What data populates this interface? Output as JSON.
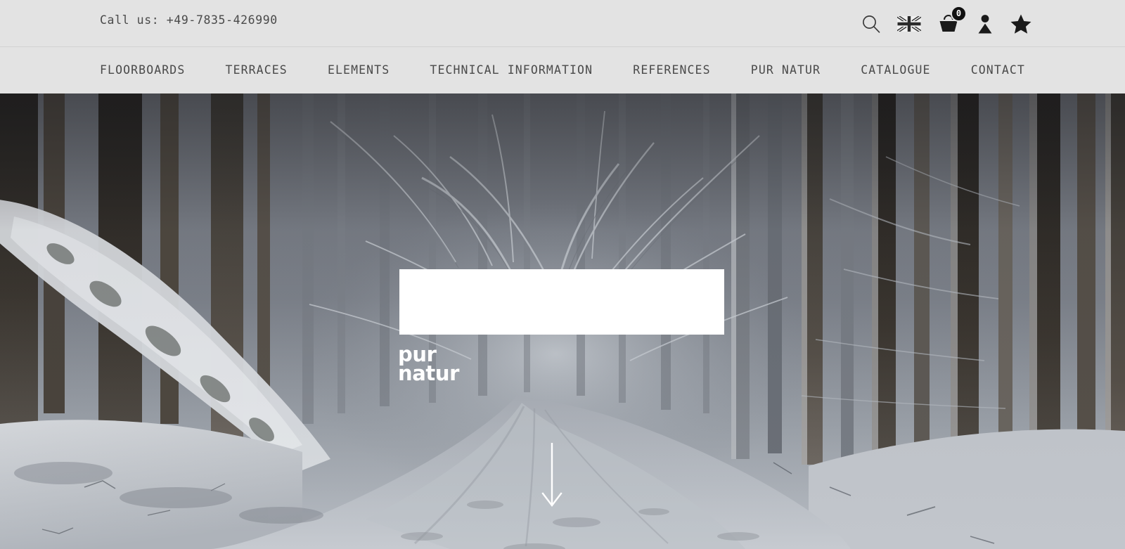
{
  "site": {
    "brand_line1": "pur",
    "brand_line2": "natur",
    "accent_color": "#ffffff",
    "header_bg": "#e3e3e3",
    "text_color": "#4a4a4a"
  },
  "topbar": {
    "phone_text": "Call us: +49-7835-426990",
    "icons": [
      {
        "name": "search-icon",
        "label": "Search"
      },
      {
        "name": "flag-en-icon",
        "label": "English"
      },
      {
        "name": "shopping-bag-icon",
        "label": "Basket",
        "badge": "0"
      },
      {
        "name": "user-account-icon",
        "label": "Account"
      },
      {
        "name": "favourites-star-icon",
        "label": "Favourites"
      }
    ],
    "cart_count": "0"
  },
  "nav": {
    "items": [
      {
        "label": "FLOORBOARDS"
      },
      {
        "label": "TERRACES"
      },
      {
        "label": "ELEMENTS"
      },
      {
        "label": "TECHNICAL INFORMATION"
      },
      {
        "label": "REFERENCES"
      },
      {
        "label": "PUR NATUR"
      },
      {
        "label": "CATALOGUE"
      },
      {
        "label": "CONTACT"
      }
    ]
  },
  "hero": {
    "image_description": "Snow-covered forest road between dark spruce trunks",
    "card_text": "",
    "scroll_hint_icon": "arrow-down-icon"
  }
}
